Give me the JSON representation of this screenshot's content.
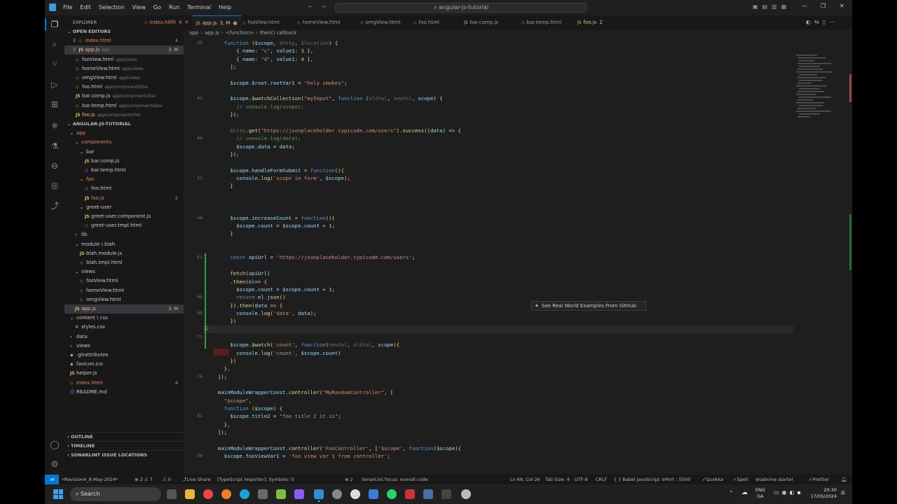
{
  "window": {
    "search_title": "angular-js-tutorial",
    "menu": [
      "File",
      "Edit",
      "Selection",
      "View",
      "Go",
      "Run",
      "Terminal",
      "Help"
    ]
  },
  "explorer": {
    "title": "EXPLORER",
    "open_editors_label": "OPEN EDITORS",
    "open_editors": [
      {
        "name": "index.html",
        "path": "",
        "badge": "4",
        "color": "#e8825c"
      },
      {
        "name": "app.js",
        "path": "app",
        "badge": "3, M",
        "color": "#e2c08d"
      },
      {
        "name": "fooView.html",
        "path": "app\\views",
        "badge": "",
        "color": "#c8c8c8"
      },
      {
        "name": "homeView.html",
        "path": "app\\views",
        "badge": "",
        "color": "#c8c8c8"
      },
      {
        "name": "omgView.html",
        "path": "app\\views",
        "badge": "",
        "color": "#c8c8c8"
      },
      {
        "name": "foo.html",
        "path": "app\\components\\foo",
        "badge": "",
        "color": "#c8c8c8"
      },
      {
        "name": "bar.comp.js",
        "path": "app\\components\\bar",
        "badge": "",
        "color": "#c8c8c8"
      },
      {
        "name": "bar.temp.html",
        "path": "app\\components\\bar",
        "badge": "",
        "color": "#c8c8c8"
      },
      {
        "name": "foo.js",
        "path": "app\\components\\foo",
        "badge": "",
        "color": "#e2c08d"
      }
    ],
    "project_label": "ANGULAR-JS-TUTORIAL",
    "tree": [
      {
        "name": "app",
        "depth": 0,
        "kind": "folder",
        "color": "#e8825c",
        "badge": ""
      },
      {
        "name": "components",
        "depth": 1,
        "kind": "folder",
        "color": "#e8825c",
        "badge": ""
      },
      {
        "name": "bar",
        "depth": 2,
        "kind": "folder",
        "color": "#c8c8c8",
        "badge": ""
      },
      {
        "name": "bar.comp.js",
        "depth": 3,
        "kind": "js",
        "color": "#c8c8c8",
        "badge": ""
      },
      {
        "name": "bar.temp.html",
        "depth": 3,
        "kind": "html",
        "color": "#c8c8c8",
        "badge": ""
      },
      {
        "name": "foo",
        "depth": 2,
        "kind": "folder",
        "color": "#e8825c",
        "badge": ""
      },
      {
        "name": "foo.html",
        "depth": 3,
        "kind": "html",
        "color": "#c8c8c8",
        "badge": ""
      },
      {
        "name": "foo.js",
        "depth": 3,
        "kind": "js",
        "color": "#e8825c",
        "badge": "2"
      },
      {
        "name": "greet-user",
        "depth": 2,
        "kind": "folder",
        "color": "#c8c8c8",
        "badge": ""
      },
      {
        "name": "greet-user.component.js",
        "depth": 3,
        "kind": "js",
        "color": "#c8c8c8",
        "badge": ""
      },
      {
        "name": "greet-user.tmpl.html",
        "depth": 3,
        "kind": "html",
        "color": "#c8c8c8",
        "badge": ""
      },
      {
        "name": "lib",
        "depth": 1,
        "kind": "folder-c",
        "color": "#c8c8c8",
        "badge": ""
      },
      {
        "name": "module \\ blah",
        "depth": 1,
        "kind": "folder",
        "color": "#c8c8c8",
        "badge": ""
      },
      {
        "name": "blah.module.js",
        "depth": 2,
        "kind": "js",
        "color": "#c8c8c8",
        "badge": ""
      },
      {
        "name": "blah.tmpl.html",
        "depth": 2,
        "kind": "html",
        "color": "#c8c8c8",
        "badge": ""
      },
      {
        "name": "views",
        "depth": 1,
        "kind": "folder",
        "color": "#c8c8c8",
        "badge": ""
      },
      {
        "name": "fooView.html",
        "depth": 2,
        "kind": "html",
        "color": "#c8c8c8",
        "badge": ""
      },
      {
        "name": "homeView.html",
        "depth": 2,
        "kind": "html",
        "color": "#c8c8c8",
        "badge": ""
      },
      {
        "name": "omgView.html",
        "depth": 2,
        "kind": "html",
        "color": "#c8c8c8",
        "badge": ""
      },
      {
        "name": "app.js",
        "depth": 1,
        "kind": "js",
        "color": "#e2c08d",
        "badge": "3, M"
      },
      {
        "name": "content \\ css",
        "depth": 0,
        "kind": "folder",
        "color": "#c8c8c8",
        "badge": ""
      },
      {
        "name": "styles.css",
        "depth": 1,
        "kind": "css",
        "color": "#c8c8c8",
        "badge": ""
      },
      {
        "name": "data",
        "depth": 0,
        "kind": "folder-c",
        "color": "#c8c8c8",
        "badge": ""
      },
      {
        "name": "views",
        "depth": 0,
        "kind": "folder-c",
        "color": "#c8c8c8",
        "badge": ""
      },
      {
        "name": ".gitattributes",
        "depth": 0,
        "kind": "file",
        "color": "#c8c8c8",
        "badge": ""
      },
      {
        "name": "favicon.ico",
        "depth": 0,
        "kind": "file",
        "color": "#c8c8c8",
        "badge": ""
      },
      {
        "name": "helper.js",
        "depth": 0,
        "kind": "js",
        "color": "#c8c8c8",
        "badge": ""
      },
      {
        "name": "index.html",
        "depth": 0,
        "kind": "html",
        "color": "#e8825c",
        "badge": "4"
      },
      {
        "name": "README.md",
        "depth": 0,
        "kind": "md",
        "color": "#c8c8c8",
        "badge": ""
      }
    ],
    "bottom_sections": [
      "OUTLINE",
      "TIMELINE",
      "SONARLINT ISSUE LOCATIONS"
    ]
  },
  "tabs": [
    {
      "label": "index.html",
      "badge": "4",
      "color": "#e8825c"
    },
    {
      "label": "app.js",
      "badge": "3, M",
      "color": "#e2c08d"
    },
    {
      "label": "fooView.html",
      "badge": "",
      "color": "#9d9d9d"
    },
    {
      "label": "homeView.html",
      "badge": "",
      "color": "#9d9d9d"
    },
    {
      "label": "omgView.html",
      "badge": "",
      "color": "#9d9d9d"
    },
    {
      "label": "foo.html",
      "badge": "",
      "color": "#9d9d9d"
    },
    {
      "label": "bar.comp.js",
      "badge": "",
      "color": "#9d9d9d"
    },
    {
      "label": "bar.temp.html",
      "badge": "",
      "color": "#9d9d9d"
    },
    {
      "label": "foo.js",
      "badge": "2",
      "color": "#e2c08d"
    }
  ],
  "breadcrumb": [
    "app",
    "app.js",
    "<function>",
    "then() callback"
  ],
  "code": [
    {
      "n": "35",
      "t": "    function ($scope, $http, $location) {"
    },
    {
      "n": "",
      "t": "        { name: \"c\", value1: 3 },"
    },
    {
      "n": "",
      "t": "        { name: \"d\", value1: 4 },"
    },
    {
      "n": "",
      "t": "      ];"
    },
    {
      "n": "",
      "t": ""
    },
    {
      "n": "",
      "t": "      $scope.$root.rootVar1 = \"holy smokes\";"
    },
    {
      "n": "",
      "t": ""
    },
    {
      "n": "41",
      "t": "      $scope.$watchCollection(\"myInput\", function (oldVal, newVal, scope) {"
    },
    {
      "n": "",
      "t": "        // console.log(scope);"
    },
    {
      "n": "",
      "t": "      });"
    },
    {
      "n": "",
      "t": ""
    },
    {
      "n": "",
      "t": "      $http.get(\"https://jsonplaceholder.typicode.com/users\").success((data) => {"
    },
    {
      "n": "46",
      "t": "        // console.log(data);"
    },
    {
      "n": "",
      "t": "        $scope.data = data;"
    },
    {
      "n": "",
      "t": "      });"
    },
    {
      "n": "",
      "t": ""
    },
    {
      "n": "",
      "t": "      $scope.handleFormSubmit = function(){"
    },
    {
      "n": "51",
      "t": "        console.log('scope in form', $scope);"
    },
    {
      "n": "",
      "t": "      }"
    },
    {
      "n": "",
      "t": ""
    },
    {
      "n": "",
      "t": ""
    },
    {
      "n": "",
      "t": ""
    },
    {
      "n": "56",
      "t": "      $scope.increaseCount = function(){"
    },
    {
      "n": "",
      "t": "        $scope.count = $scope.count + 1;"
    },
    {
      "n": "",
      "t": "      }"
    },
    {
      "n": "",
      "t": ""
    },
    {
      "n": "",
      "t": ""
    },
    {
      "n": "61",
      "t": "      const apiUrl = 'https://jsonplaceholder.typicode.com/users';"
    },
    {
      "n": "",
      "t": ""
    },
    {
      "n": "",
      "t": "      fetch(apiUrl)"
    },
    {
      "n": "",
      "t": "      .then(el=> {"
    },
    {
      "n": "",
      "t": "        $scope.count = $scope.count + 1;"
    },
    {
      "n": "66",
      "t": "        return el.json()"
    },
    {
      "n": "",
      "t": "      }).then(data => {"
    },
    {
      "n": "68",
      "t": "        console.log('data', data);"
    },
    {
      "n": "",
      "t": "      })"
    },
    {
      "n": "",
      "t": ""
    },
    {
      "n": "71",
      "t": ""
    },
    {
      "n": "",
      "t": "      $scope.$watch('count', function(newVal, oldVal, scope){"
    },
    {
      "n": "",
      "t": "        console.log('count', $scope.count)"
    },
    {
      "n": "",
      "t": "      })"
    },
    {
      "n": "",
      "t": "    },"
    },
    {
      "n": "76",
      "t": "  ]);"
    },
    {
      "n": "",
      "t": ""
    },
    {
      "n": "",
      "t": "  mainModuleWrapperConst.controller(\"MyRandomController\", ["
    },
    {
      "n": "",
      "t": "    \"$scope\","
    },
    {
      "n": "",
      "t": "    function ($scope) {"
    },
    {
      "n": "81",
      "t": "      $scope.title2 = \"foo title 2 it is\";"
    },
    {
      "n": "",
      "t": "    },"
    },
    {
      "n": "",
      "t": "  ]);"
    },
    {
      "n": "",
      "t": ""
    },
    {
      "n": "",
      "t": "  mainModuleWrapperConst.controller('FooController', ['$scope', function($scope){"
    },
    {
      "n": "86",
      "t": "    $scope.fooViewVar1 = 'foo view var 1 from controller';"
    }
  ],
  "hover_hint": "See Real World Examples From GitHub",
  "status": {
    "branch": "Revision4_8-May-2024*",
    "sync": "⊗ 2 ⚠ 7",
    "warn": "⚠ 0",
    "live_share": "Live Share",
    "ts": "[TypeScript Importer]: Symbols: 0",
    "sonar_count": "⊗ 2",
    "sonar": "SonarLint focus: overall code",
    "position": "Ln 68, Col 26",
    "tab": "Tab Size: 4",
    "enc": "UTF-8",
    "eol": "CRLF",
    "lang": "{ } Babel JavaScript",
    "port": "Port : 5500",
    "quokka": "Quokka",
    "spell": "Spell",
    "tabnine": "tabnine starter",
    "prettier": "Prettier"
  },
  "taskbar": {
    "search": "Search",
    "lang": "ENG",
    "lang2": "GA",
    "time": "20:30",
    "date": "17/05/2024"
  }
}
